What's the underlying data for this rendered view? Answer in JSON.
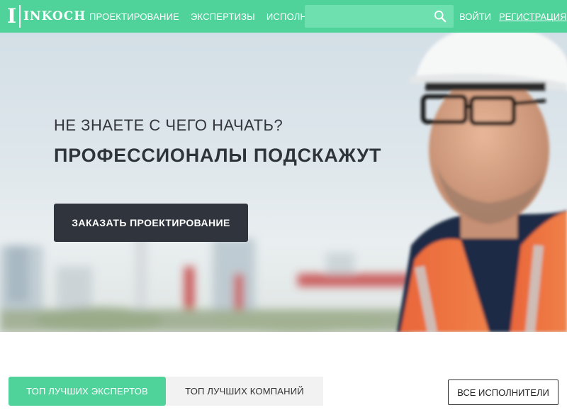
{
  "header": {
    "logo_mark": "I",
    "logo_text": "INKOCH",
    "nav": [
      "ПРОЕКТИРОВАНИЕ",
      "ЭКСПЕРТИЗЫ",
      "ИСПОЛНИТЕЛИ"
    ],
    "search_value": "",
    "search_icon": "search-icon",
    "login": "ВОЙТИ",
    "register": "РЕГИСТРАЦИЯ"
  },
  "hero": {
    "subtitle": "НЕ ЗНАЕТЕ С ЧЕГО НАЧАТЬ?",
    "title": "ПРОФЕССИОНАЛЫ ПОДСКАЖУТ",
    "cta": "ЗАКАЗАТЬ ПРОЕКТИРОВАНИЕ"
  },
  "tabs": {
    "experts": "ТОП ЛУЧШИХ ЭКСПЕРТОВ",
    "companies": "ТОП ЛУЧШИХ КОМПАНИЙ",
    "all": "ВСЕ ИСПОЛНИТЕЛИ"
  },
  "colors": {
    "brand_green": "#4fd39a",
    "dark_button": "#2f343d"
  }
}
